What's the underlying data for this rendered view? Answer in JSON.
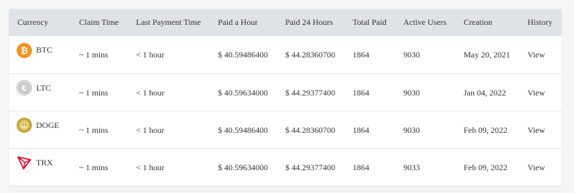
{
  "columns": [
    "Currency",
    "Claim Time",
    "Last Payment Time",
    "Paid a Hour",
    "Paid 24 Hours",
    "Total Paid",
    "Active Users",
    "Creation",
    "History"
  ],
  "rows": [
    {
      "coin": "BTC",
      "icon": "bitcoin-icon",
      "claim": "~ 1 mins",
      "last_payment": "< 1 hour",
      "paid_hour": "$ 40.59486400",
      "paid_24h": "$ 44.28360700",
      "total_paid": "1864",
      "active_users": "9030",
      "creation": "May 20, 2021",
      "history": "View"
    },
    {
      "coin": "LTC",
      "icon": "litecoin-icon",
      "claim": "~ 1 mins",
      "last_payment": "< 1 hour",
      "paid_hour": "$ 40.59634000",
      "paid_24h": "$ 44.29377400",
      "total_paid": "1864",
      "active_users": "9030",
      "creation": "Jan 04, 2022",
      "history": "View"
    },
    {
      "coin": "DOGE",
      "icon": "dogecoin-icon",
      "claim": "~ 1 mins",
      "last_payment": "< 1 hour",
      "paid_hour": "$ 40.59486400",
      "paid_24h": "$ 44.28360700",
      "total_paid": "1864",
      "active_users": "9030",
      "creation": "Feb 09, 2022",
      "history": "View"
    },
    {
      "coin": "TRX",
      "icon": "tron-icon",
      "claim": "~ 1 mins",
      "last_payment": "< 1 hour",
      "paid_hour": "$ 40.59634000",
      "paid_24h": "$ 44.29377400",
      "total_paid": "1864",
      "active_users": "9033",
      "creation": "Feb 09, 2022",
      "history": "View"
    }
  ],
  "colors": {
    "header_bg": "#dfe3e8",
    "btc": "#f7931a",
    "ltc": "#bebebe",
    "doge": "#c2a633",
    "trx": "#eb0029"
  }
}
